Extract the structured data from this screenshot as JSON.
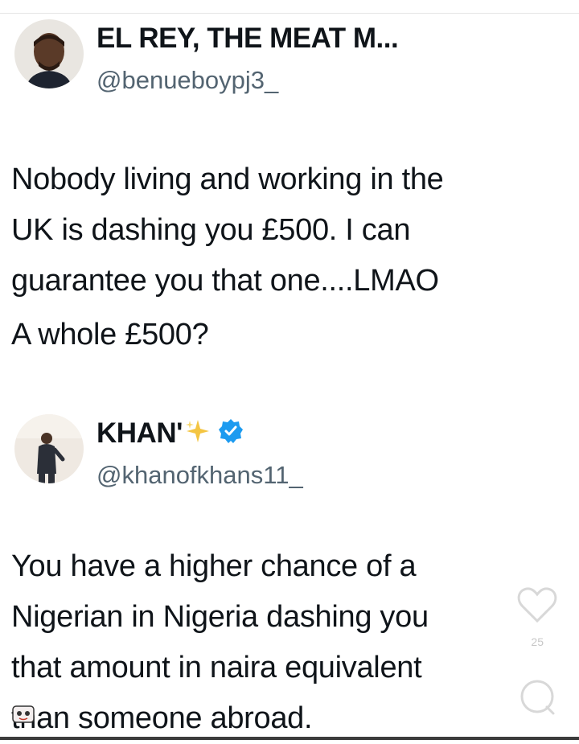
{
  "tweets": [
    {
      "display_name": "EL REY, THE MEAT M...",
      "handle": "@benueboypj3_",
      "text_lines": [
        "Nobody living and working in the",
        "UK is dashing you £500. I can",
        "guarantee you that one....LMAO"
      ],
      "text_tail": "A whole £500?"
    },
    {
      "display_name": "KHAN'",
      "handle": "@khanofkhans11_",
      "verified": true,
      "text_lines": [
        "You have a higher chance of a",
        "Nigerian in Nigeria dashing you",
        "that amount in naira equivalent",
        "than someone abroad."
      ]
    }
  ],
  "overlay": {
    "like_count": "25",
    "icons": [
      "heart-icon",
      "comment-icon"
    ]
  },
  "colors": {
    "text": "#0f1419",
    "handle": "#536471",
    "verified": "#1d9bf0",
    "sparkle": "#f4c542"
  }
}
